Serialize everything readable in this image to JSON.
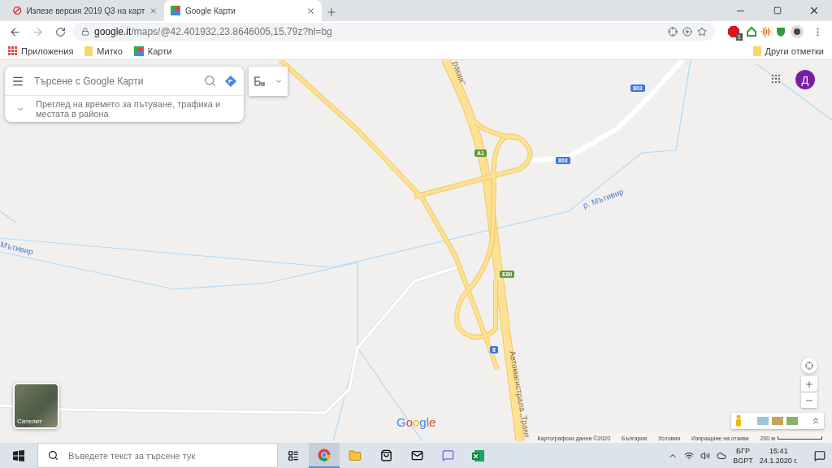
{
  "browser": {
    "tabs": [
      {
        "title": "Излезе версия 2019 Q3 на карт",
        "selected": false,
        "kind": "blocked"
      },
      {
        "title": "Google Карти",
        "selected": true,
        "kind": "maps"
      }
    ],
    "url_host": "google.it",
    "url_path": "/maps/@42.401932,23.8646005,15.79z?hl=bg",
    "extension_badge": "1",
    "bookmarks": [
      {
        "label": "Приложения",
        "kind": "apps"
      },
      {
        "label": "Митко",
        "kind": "folder"
      },
      {
        "label": "Карти",
        "kind": "maps"
      }
    ],
    "other_bookmarks": "Други отметки"
  },
  "maps": {
    "search_placeholder": "Търсене с Google Карти",
    "explore": "Преглед на времето за пътуване, трафика и местата в района",
    "avatar": "Д",
    "layer_button": "Сателит",
    "logo": "Google",
    "road_shields": [
      {
        "text": "803",
        "color": "#3b78d8"
      },
      {
        "text": "A1",
        "color": "#5c9a38"
      },
      {
        "text": "803",
        "color": "#3b78d8"
      },
      {
        "text": "E80",
        "color": "#5c9a38"
      },
      {
        "text": "8",
        "color": "#3b78d8"
      }
    ],
    "labels": [
      {
        "text": "ракия“",
        "kind": "road"
      },
      {
        "text": "р. Мътивир",
        "kind": "river"
      },
      {
        "text": "Мътивир",
        "kind": "river"
      },
      {
        "text": "Автомагистрала „Траки",
        "kind": "road"
      }
    ],
    "footer": [
      "Картографски данни ©2020",
      "България",
      "Условия",
      "Изпращане на отзиви"
    ],
    "scale": "200 м"
  },
  "taskbar": {
    "search_placeholder": "Въведете текст за търсене тук",
    "lang_top": "БГР",
    "lang_bottom": "BGPT",
    "time": "15:41",
    "date": "24.1.2020 г."
  }
}
